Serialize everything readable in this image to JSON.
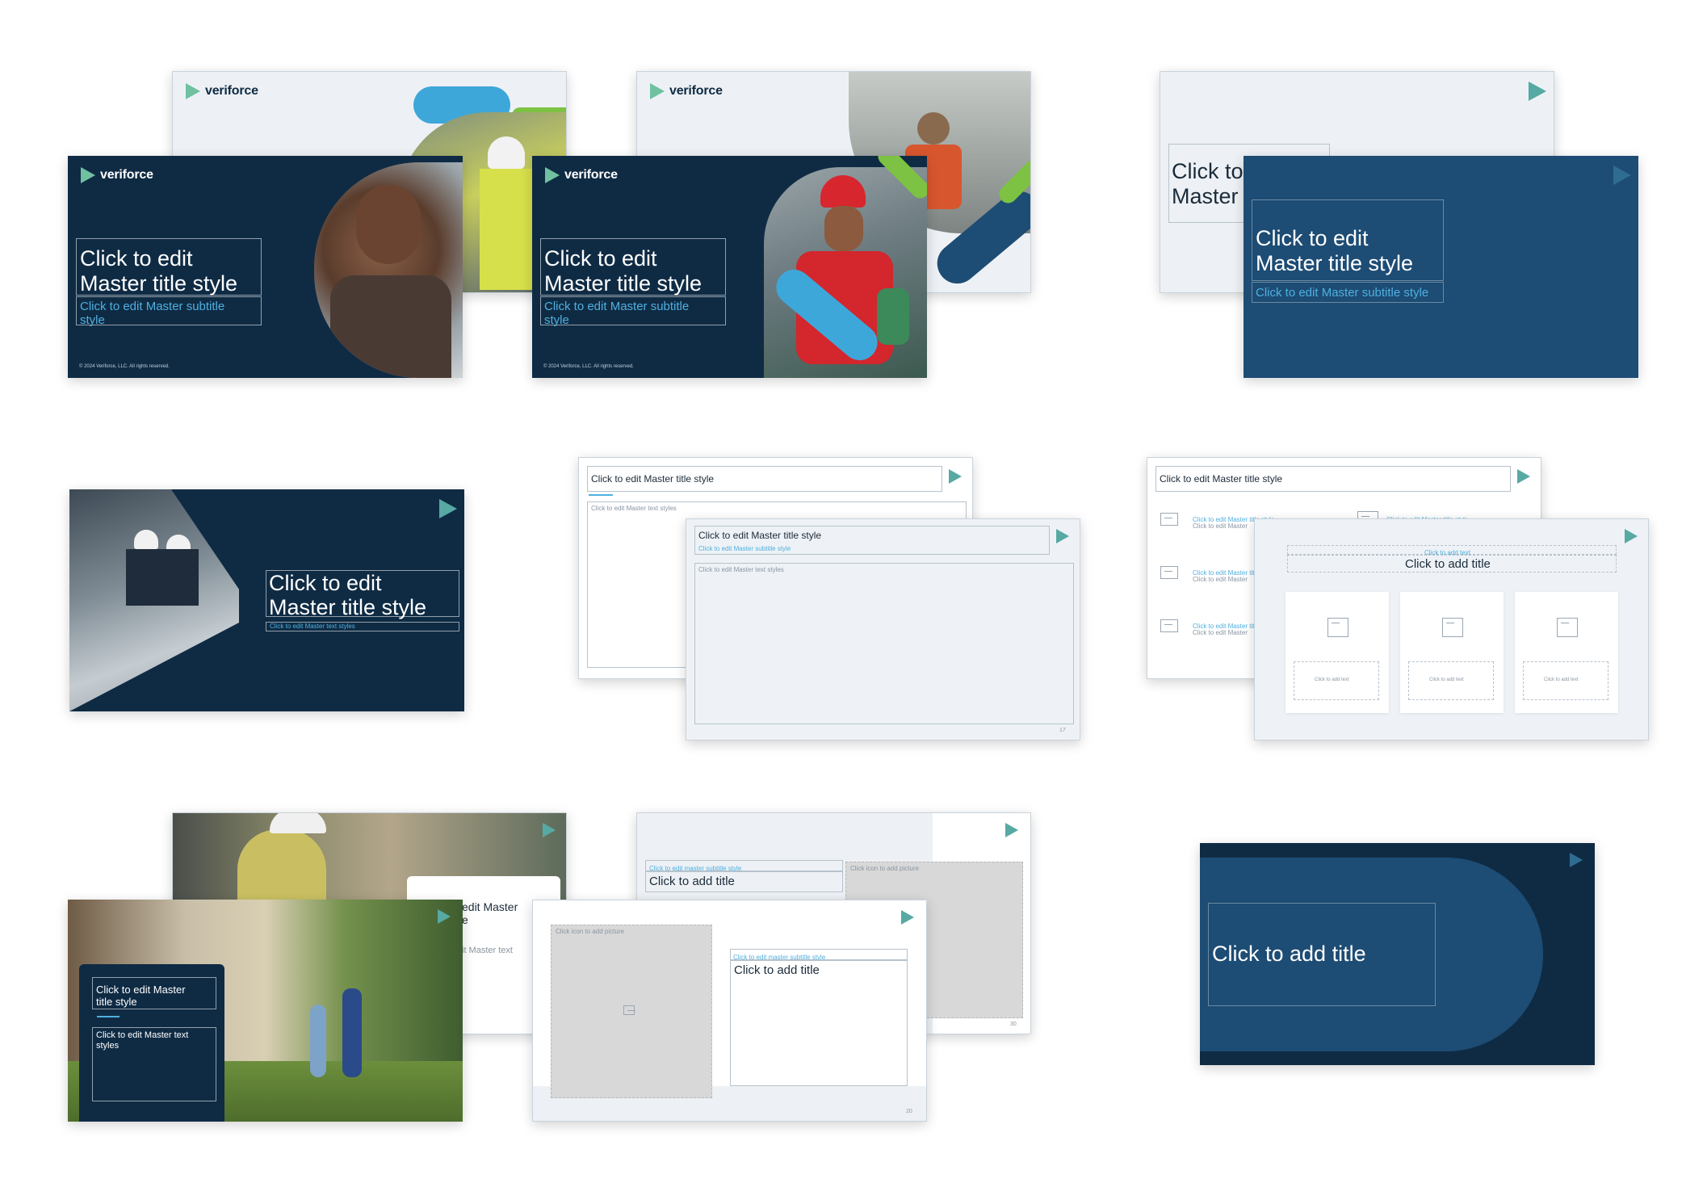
{
  "brand": {
    "name": "veriforce"
  },
  "placeholders": {
    "master_title": "Click to edit Master title style",
    "master_title_line1": "Click to edit",
    "master_title_line2": "Master title style",
    "master_subtitle": "Click to edit Master subtitle style",
    "master_text": "Click to edit Master text styles",
    "add_title": "Click to add title",
    "add_text": "Click to add text",
    "add_picture": "Click icon to add picture",
    "master_subtitle_lower": "Click to edit master subtitle style",
    "master_title_lower_short": "Click to edit Master title style",
    "partial_click_to": "Click to",
    "partial_master": "Master",
    "partial_edit_master": "edit Master",
    "partial_e": "e",
    "partial_master_text": "it Master text",
    "master_title_two_line_a": "Click to edit Master",
    "master_title_two_line_b": "title style",
    "master_text_two_line_a": "Click to edit Master text",
    "master_text_two_line_b": "styles",
    "master_subtitle_two_line_a": "Click to edit Master subtitle",
    "master_subtitle_two_line_b": "style",
    "master_title_style_short": "Click to edit Master title style",
    "click_to_edit_master": "Click to edit Master"
  },
  "footer": {
    "copyright": "© 2024 Veriforce, LLC. All rights reserved."
  },
  "page_numbers": [
    "17",
    "20",
    "30"
  ],
  "colors": {
    "navy": "#0f2b44",
    "blue": "#1d4c74",
    "accent_blue": "#4fb0e0",
    "accent_green": "#7dc242",
    "accent_teal": "#57a9a3"
  }
}
